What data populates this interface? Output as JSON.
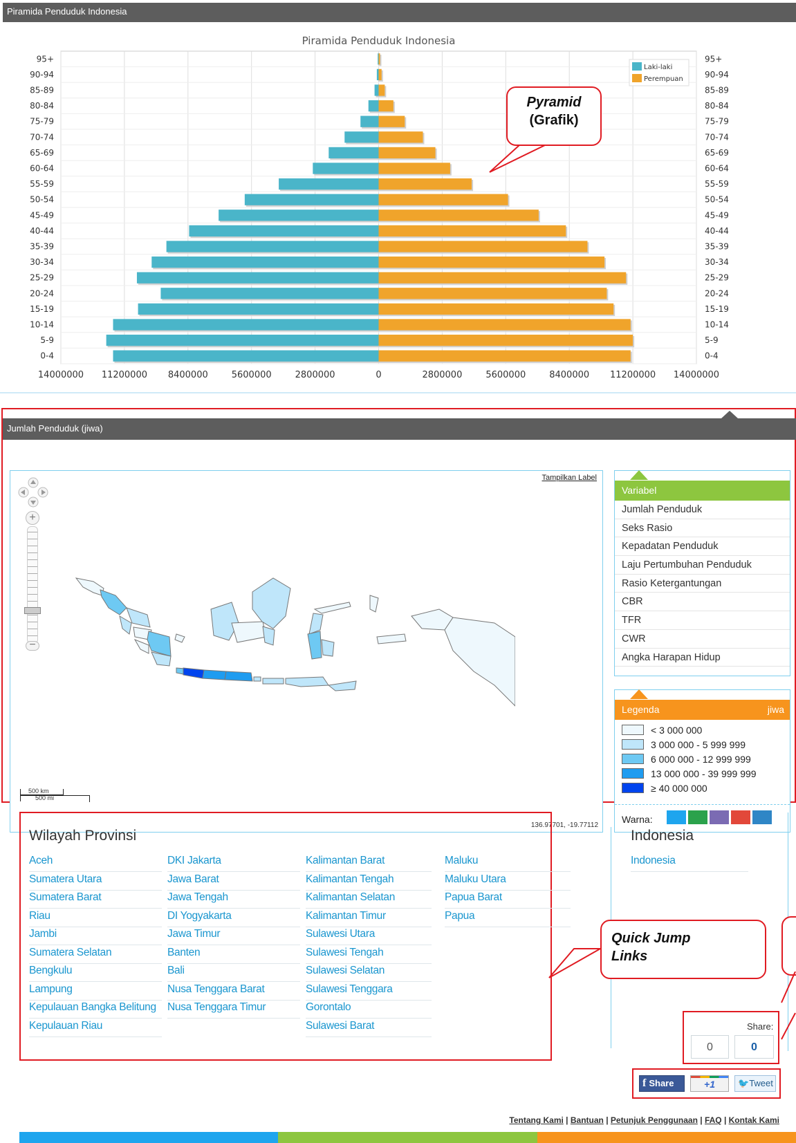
{
  "top_panel": {
    "title": "Piramida Penduduk Indonesia"
  },
  "chart_data": {
    "type": "bar",
    "title": "Piramida Penduduk Indonesia",
    "orientation": "horizontal-population-pyramid",
    "categories": [
      "0-4",
      "5-9",
      "10-14",
      "15-19",
      "20-24",
      "25-29",
      "30-34",
      "35-39",
      "40-44",
      "45-49",
      "50-54",
      "55-59",
      "60-64",
      "65-69",
      "70-74",
      "75-79",
      "80-84",
      "85-89",
      "90-94",
      "95+"
    ],
    "series": [
      {
        "name": "Laki-laki",
        "color": "#4ab5c9",
        "values": [
          11700000,
          12000000,
          11700000,
          10600000,
          9600000,
          10650000,
          10000000,
          9350000,
          8350000,
          7050000,
          5900000,
          4400000,
          2900000,
          2200000,
          1500000,
          800000,
          450000,
          180000,
          80000,
          40000
        ]
      },
      {
        "name": "Perempuan",
        "color": "#f0a42b",
        "values": [
          11100000,
          11200000,
          11100000,
          10350000,
          10050000,
          10900000,
          9950000,
          9200000,
          8250000,
          7050000,
          5700000,
          4100000,
          3150000,
          2500000,
          1950000,
          1150000,
          650000,
          270000,
          130000,
          60000
        ]
      }
    ],
    "xlim": [
      -14000000,
      14000000
    ],
    "x_ticks": [
      "14000000",
      "11200000",
      "8400000",
      "5600000",
      "2800000",
      "0",
      "2800000",
      "5600000",
      "8400000",
      "11200000",
      "14000000"
    ],
    "legend_position": "top-right",
    "grid": true
  },
  "annotations": {
    "pyramid_line1": "Pyramid",
    "pyramid_line2": "(Grafik)",
    "quick_jump_line1": "Quick Jump",
    "quick_jump_line2": "Links"
  },
  "map_panel": {
    "title": "Jumlah Penduduk (jiwa)",
    "show_labels_link": "Tampilkan Label",
    "scale_km": "500 km",
    "scale_mi": "500 mi",
    "coordinates": "136.97701, -19.77112"
  },
  "variabel": {
    "title": "Variabel",
    "items": [
      "Jumlah Penduduk",
      "Seks Rasio",
      "Kepadatan Penduduk",
      "Laju Pertumbuhan Penduduk",
      "Rasio Ketergantungan",
      "CBR",
      "TFR",
      "CWR",
      "Angka Harapan Hidup"
    ]
  },
  "legenda": {
    "title": "Legenda",
    "unit": "jiwa",
    "items": [
      {
        "label": "< 3 000 000",
        "color": "#eef8fd"
      },
      {
        "label": "3 000 000 - 5 999 999",
        "color": "#bfe6fa"
      },
      {
        "label": "6 000 000 - 12 999 999",
        "color": "#6ec9f3"
      },
      {
        "label": "13 000 000 - 39 999 999",
        "color": "#1f9cf0"
      },
      {
        "label": "≥ 40 000 000",
        "color": "#0044ee"
      }
    ],
    "warna_label": "Warna:",
    "warna_colors": [
      "#1ea5ee",
      "#2ba24c",
      "#7b6bb3",
      "#e2483a",
      "#2f86c6"
    ]
  },
  "provinces": {
    "title": "Wilayah Provinsi",
    "columns": [
      [
        "Aceh",
        "Sumatera Utara",
        "Sumatera Barat",
        "Riau",
        "Jambi",
        "Sumatera Selatan",
        "Bengkulu",
        "Lampung",
        "Kepulauan Bangka Belitung",
        "Kepulauan Riau"
      ],
      [
        "DKI Jakarta",
        "Jawa Barat",
        "Jawa Tengah",
        "DI Yogyakarta",
        "Jawa Timur",
        "Banten",
        "Bali",
        "Nusa Tenggara Barat",
        "Nusa Tenggara Timur"
      ],
      [
        "Kalimantan Barat",
        "Kalimantan Tengah",
        "Kalimantan Selatan",
        "Kalimantan Timur",
        "Sulawesi Utara",
        "Sulawesi Tengah",
        "Sulawesi Selatan",
        "Sulawesi Tenggara",
        "Gorontalo",
        "Sulawesi Barat"
      ],
      [
        "Maluku",
        "Maluku Utara",
        "Papua Barat",
        "Papua"
      ]
    ]
  },
  "indonesia": {
    "title": "Indonesia",
    "link": "Indonesia"
  },
  "share": {
    "label": "Share:",
    "count_left": "0",
    "count_right": "0",
    "facebook": "Share",
    "gplus": "+1",
    "twitter": "Tweet"
  },
  "footer": {
    "links": [
      "Tentang Kami",
      "Bantuan",
      "Petunjuk Penggunaan",
      "FAQ",
      "Kontak Kami"
    ],
    "separator": "|"
  }
}
